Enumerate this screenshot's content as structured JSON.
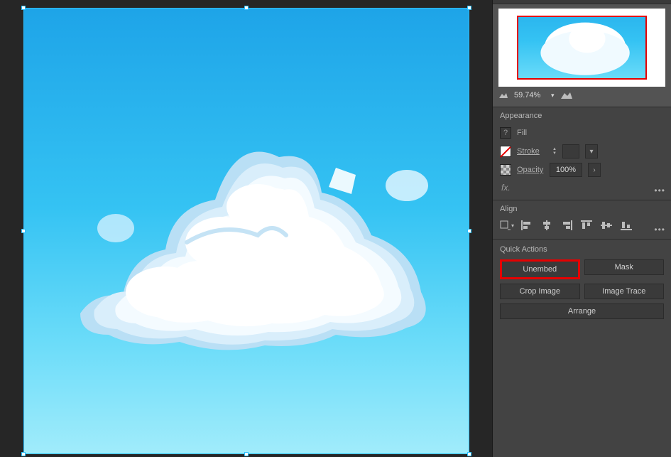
{
  "navigator": {
    "zoom_value": "59.74%"
  },
  "appearance": {
    "section_title": "Appearance",
    "fill_label": "Fill",
    "stroke_label": "Stroke",
    "opacity_label": "Opacity",
    "opacity_value": "100%",
    "fx_label": "fx."
  },
  "align": {
    "section_title": "Align"
  },
  "quick_actions": {
    "section_title": "Quick Actions",
    "unembed": "Unembed",
    "mask": "Mask",
    "crop_image": "Crop Image",
    "image_trace": "Image Trace",
    "arrange": "Arrange"
  }
}
